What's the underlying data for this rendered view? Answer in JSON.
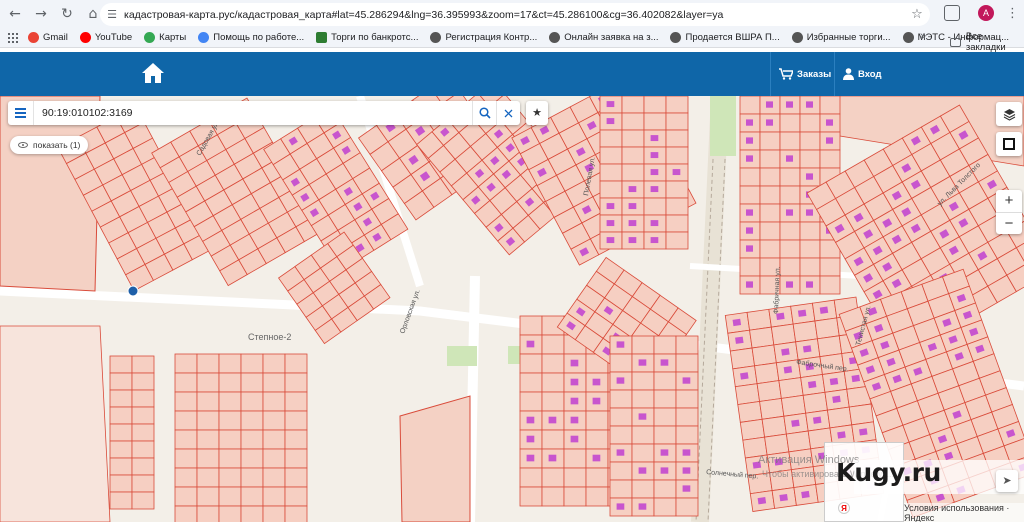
{
  "browser": {
    "url": "кадастровая-карта.рус/кадастровая_карта#lat=45.286294&lng=36.395993&zoom=17&ct=45.286100&cg=36.402082&layer=ya",
    "profile_initial": "A",
    "nav_icons": [
      "back-icon",
      "forward-icon",
      "reload-icon",
      "home-icon"
    ]
  },
  "bookmarks": {
    "items": [
      {
        "label": "Gmail",
        "color": "#ea4335"
      },
      {
        "label": "YouTube",
        "color": "#ff0000"
      },
      {
        "label": "Карты",
        "color": "#34a853"
      },
      {
        "label": "Помощь по работе...",
        "color": "#4285f4"
      },
      {
        "label": "Торги по банкротс...",
        "color": "#2e7d32"
      },
      {
        "label": "Регистрация Контр...",
        "color": "#555555"
      },
      {
        "label": "Онлайн заявка на з...",
        "color": "#555555"
      },
      {
        "label": "Продается ВШРА П...",
        "color": "#555555"
      },
      {
        "label": "Избранные торги...",
        "color": "#555555"
      },
      {
        "label": "МЭТС - Информац...",
        "color": "#555555"
      }
    ],
    "more": "»",
    "all_label": "Все закладки"
  },
  "site_header": {
    "orders_label": "Заказы",
    "login_label": "Вход",
    "brand_color": "#0f66a8"
  },
  "map": {
    "search_value": "90:19:010102:3169",
    "show_label": "показать (1)",
    "zoom_in": "+",
    "zoom_out": "−",
    "street_labels": [
      "Степное-2",
      "Фабричная ул.",
      "Садовая ул.",
      "Орловская ул.",
      "Солнечный пер.",
      "ул. Льва Толстого",
      "Полевая ул.",
      "Тенистая ул.",
      "Фаброчный пер."
    ],
    "watermark": "Kugy.ru",
    "activation_text": "Активация Windows",
    "activation_sub": "Чтобы активировать Windows...",
    "terms": "Условия использования · Яндекс",
    "parcel_color": "#d94b3a",
    "parcel_fill": "#f6cfc2",
    "building_color": "#c040d0"
  }
}
